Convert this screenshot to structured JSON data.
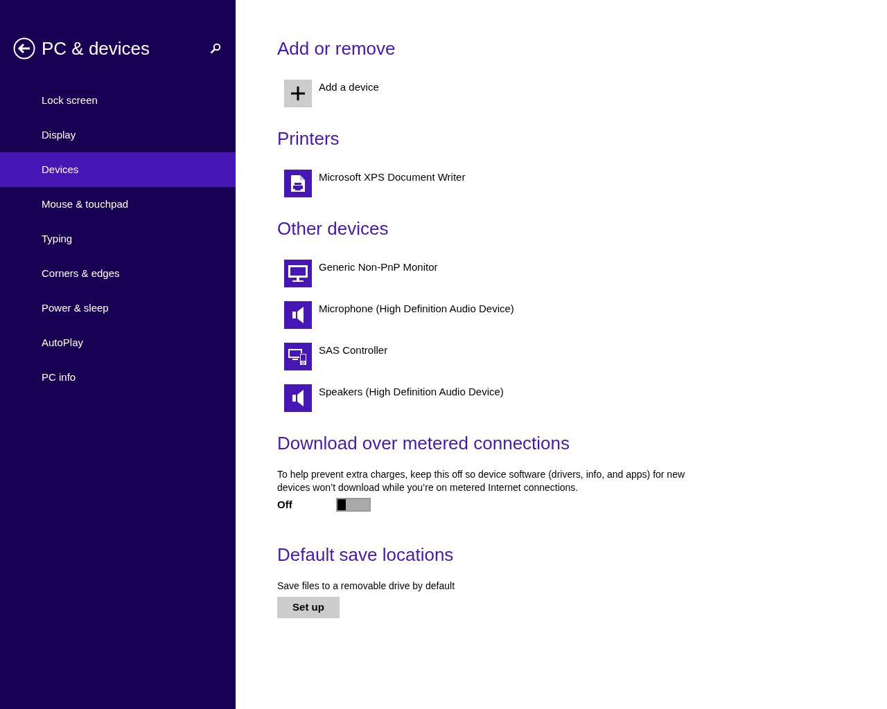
{
  "sidebar": {
    "title": "PC & devices",
    "items": [
      {
        "label": "Lock screen",
        "selected": false
      },
      {
        "label": "Display",
        "selected": false
      },
      {
        "label": "Devices",
        "selected": true
      },
      {
        "label": "Mouse & touchpad",
        "selected": false
      },
      {
        "label": "Typing",
        "selected": false
      },
      {
        "label": "Corners & edges",
        "selected": false
      },
      {
        "label": "Power & sleep",
        "selected": false
      },
      {
        "label": "AutoPlay",
        "selected": false
      },
      {
        "label": "PC info",
        "selected": false
      }
    ]
  },
  "sections": [
    {
      "kind": "devices",
      "heading": "Add or remove",
      "items": [
        {
          "kind": "add",
          "label": "Add a device"
        }
      ]
    },
    {
      "kind": "devices",
      "heading": "Printers",
      "items": [
        {
          "kind": "printer",
          "label": "Microsoft XPS Document Writer"
        }
      ]
    },
    {
      "kind": "devices",
      "heading": "Other devices",
      "items": [
        {
          "kind": "monitor",
          "label": "Generic Non-PnP Monitor"
        },
        {
          "kind": "speaker",
          "label": "Microphone (High Definition Audio Device)"
        },
        {
          "kind": "controller",
          "label": "SAS Controller"
        },
        {
          "kind": "speaker",
          "label": "Speakers (High Definition Audio Device)"
        }
      ]
    },
    {
      "kind": "toggle",
      "heading": "Download over metered connections",
      "description": "To help prevent extra charges, keep this off so device software (drivers, info, and apps) for new devices won’t download while you’re on metered Internet connections.",
      "toggle": {
        "label": "Off",
        "on": false
      }
    },
    {
      "kind": "button",
      "heading": "Default save locations",
      "description": "Save files to a removable drive by default",
      "button": "Set up"
    }
  ]
}
